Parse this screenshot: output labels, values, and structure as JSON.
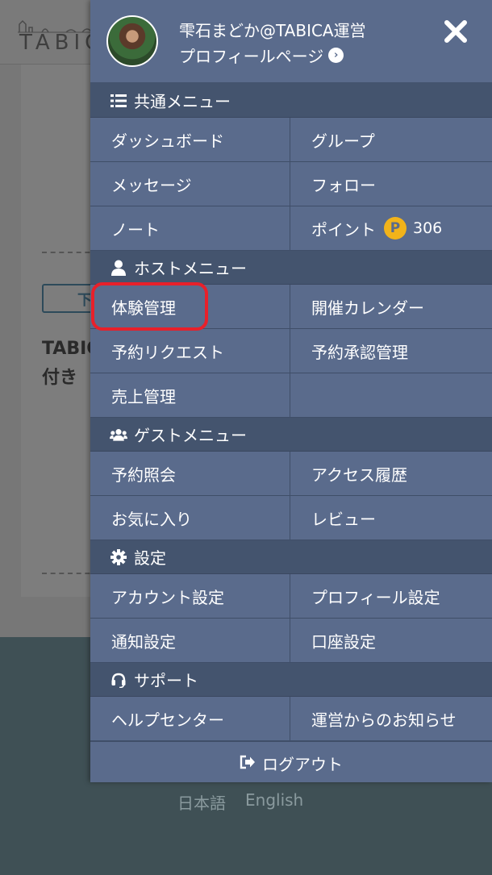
{
  "background": {
    "logo_text": "TABIC",
    "button_text": "下",
    "body_text_line1": "TABIC",
    "body_text_line2": "付き",
    "languages": [
      "日本語",
      "English"
    ]
  },
  "drawer": {
    "profile": {
      "name": "雫石まどか@TABICA運営",
      "link_label": "プロフィールページ"
    },
    "sections": [
      {
        "title": "共通メニュー",
        "icon": "list-icon",
        "items": [
          "ダッシュボード",
          "グループ",
          "メッセージ",
          "フォロー",
          "ノート",
          "ポイント"
        ]
      },
      {
        "title": "ホストメニュー",
        "icon": "user-icon",
        "items": [
          "体験管理",
          "開催カレンダー",
          "予約リクエスト",
          "予約承認管理",
          "売上管理",
          ""
        ]
      },
      {
        "title": "ゲストメニュー",
        "icon": "users-icon",
        "items": [
          "予約照会",
          "アクセス履歴",
          "お気に入り",
          "レビュー"
        ]
      },
      {
        "title": "設定",
        "icon": "gear-icon",
        "items": [
          "アカウント設定",
          "プロフィール設定",
          "通知設定",
          "口座設定"
        ]
      },
      {
        "title": "サポート",
        "icon": "headset-icon",
        "items": [
          "ヘルプセンター",
          "運営からのお知らせ"
        ]
      }
    ],
    "points": {
      "badge": "P",
      "value": "306"
    },
    "logout_label": "ログアウト",
    "colors": {
      "drawer_bg": "#5a6b8c",
      "section_bg": "#44546e",
      "point_badge": "#f2b31a",
      "highlight": "#e8202a"
    }
  }
}
